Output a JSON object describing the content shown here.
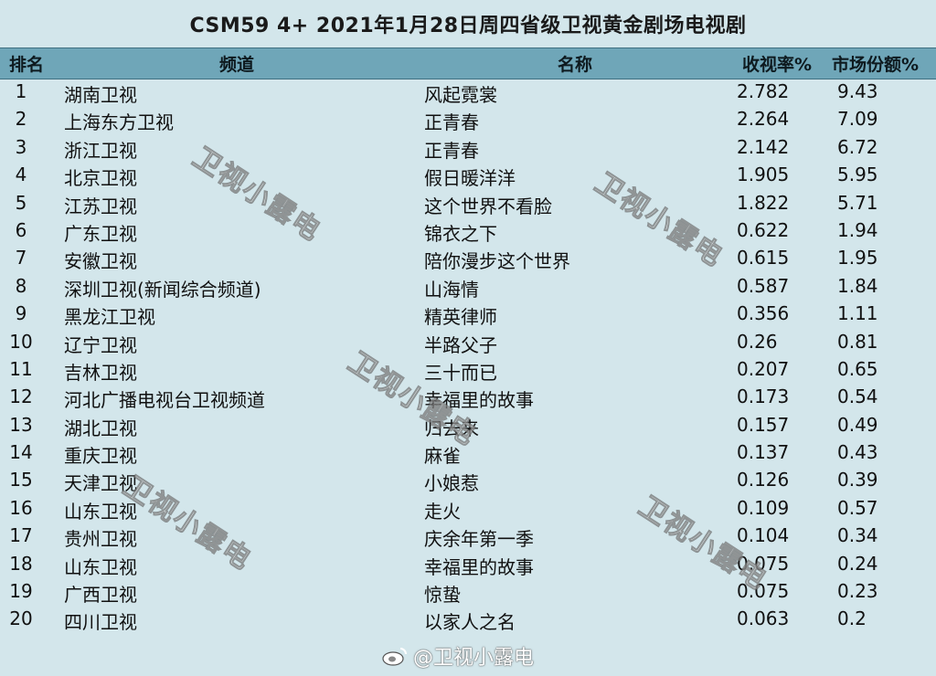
{
  "chart_data": {
    "type": "table",
    "title": "CSM59 4+ 2021年1月28日周四省级卫视黄金剧场电视剧",
    "columns": [
      "排名",
      "频道",
      "名称",
      "收视率%",
      "市场份额%"
    ],
    "rows": [
      {
        "rank": "1",
        "channel": "湖南卫视",
        "show": "风起霓裳",
        "rating": "2.782",
        "share": "9.43"
      },
      {
        "rank": "2",
        "channel": "上海东方卫视",
        "show": "正青春",
        "rating": "2.264",
        "share": "7.09"
      },
      {
        "rank": "3",
        "channel": "浙江卫视",
        "show": "正青春",
        "rating": "2.142",
        "share": "6.72"
      },
      {
        "rank": "4",
        "channel": "北京卫视",
        "show": "假日暖洋洋",
        "rating": "1.905",
        "share": "5.95"
      },
      {
        "rank": "5",
        "channel": "江苏卫视",
        "show": "这个世界不看脸",
        "rating": "1.822",
        "share": "5.71"
      },
      {
        "rank": "6",
        "channel": "广东卫视",
        "show": "锦衣之下",
        "rating": "0.622",
        "share": "1.94"
      },
      {
        "rank": "7",
        "channel": "安徽卫视",
        "show": "陪你漫步这个世界",
        "rating": "0.615",
        "share": "1.95"
      },
      {
        "rank": "8",
        "channel": "深圳卫视(新闻综合频道)",
        "show": "山海情",
        "rating": "0.587",
        "share": "1.84"
      },
      {
        "rank": "9",
        "channel": "黑龙江卫视",
        "show": "精英律师",
        "rating": "0.356",
        "share": "1.11"
      },
      {
        "rank": "10",
        "channel": "辽宁卫视",
        "show": "半路父子",
        "rating": "0.26",
        "share": "0.81"
      },
      {
        "rank": "11",
        "channel": "吉林卫视",
        "show": "三十而已",
        "rating": "0.207",
        "share": "0.65"
      },
      {
        "rank": "12",
        "channel": "河北广播电视台卫视频道",
        "show": "幸福里的故事",
        "rating": "0.173",
        "share": "0.54"
      },
      {
        "rank": "13",
        "channel": "湖北卫视",
        "show": "归去来",
        "rating": "0.157",
        "share": "0.49"
      },
      {
        "rank": "14",
        "channel": "重庆卫视",
        "show": "麻雀",
        "rating": "0.137",
        "share": "0.43"
      },
      {
        "rank": "15",
        "channel": "天津卫视",
        "show": "小娘惹",
        "rating": "0.126",
        "share": "0.39"
      },
      {
        "rank": "16",
        "channel": "山东卫视",
        "show": "走火",
        "rating": "0.109",
        "share": "0.57"
      },
      {
        "rank": "17",
        "channel": "贵州卫视",
        "show": "庆余年第一季",
        "rating": "0.104",
        "share": "0.34"
      },
      {
        "rank": "18",
        "channel": "山东卫视",
        "show": "幸福里的故事",
        "rating": "0.075",
        "share": "0.24"
      },
      {
        "rank": "19",
        "channel": "广西卫视",
        "show": "惊蛰",
        "rating": "0.075",
        "share": "0.23"
      },
      {
        "rank": "20",
        "channel": "四川卫视",
        "show": "以家人之名",
        "rating": "0.063",
        "share": "0.2"
      }
    ]
  },
  "watermarks": [
    "卫视小露电",
    "卫视小露电",
    "卫视小露电",
    "卫视小露电",
    "卫视小露电"
  ],
  "weibo_mark": "@卫视小露电",
  "colors": {
    "background": "#d3e6eb",
    "header": "#6fa6b8"
  }
}
